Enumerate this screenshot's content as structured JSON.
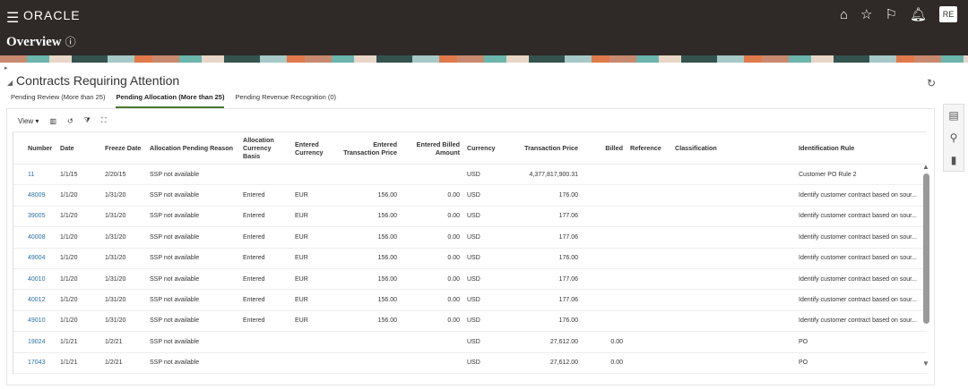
{
  "header": {
    "app": "ORACLE",
    "page_title": "Overview",
    "user_initials": "RE"
  },
  "section": {
    "title": "Contracts Requiring Attention"
  },
  "tabs": [
    {
      "label": "Pending Review (More than 25)"
    },
    {
      "label": "Pending Allocation (More than 25)"
    },
    {
      "label": "Pending Revenue Recognition (0)"
    }
  ],
  "toolbar": {
    "view_label": "View"
  },
  "columns": [
    "Number",
    "Date",
    "Freeze Date",
    "Allocation Pending Reason",
    "Allocation Currency Basis",
    "Entered Currency",
    "Entered Transaction Price",
    "Entered Billed Amount",
    "Currency",
    "Transaction Price",
    "Billed",
    "Reference",
    "Classification",
    "Identification Rule"
  ],
  "rows": [
    [
      "11",
      "1/1/15",
      "2/20/15",
      "SSP not available",
      "",
      "",
      "",
      "",
      "USD",
      "4,377,817,900.31",
      "",
      "",
      "",
      "Customer PO Rule 2"
    ],
    [
      "48009",
      "1/1/20",
      "1/31/20",
      "SSP not available",
      "Entered",
      "EUR",
      "156.00",
      "0.00",
      "USD",
      "176.00",
      "",
      "",
      "",
      "Identify customer contract based on sour..."
    ],
    [
      "39005",
      "1/1/20",
      "1/31/20",
      "SSP not available",
      "Entered",
      "EUR",
      "156.00",
      "0.00",
      "USD",
      "177.06",
      "",
      "",
      "",
      "Identify customer contract based on sour..."
    ],
    [
      "40008",
      "1/1/20",
      "1/31/20",
      "SSP not available",
      "Entered",
      "EUR",
      "156.00",
      "0.00",
      "USD",
      "177.06",
      "",
      "",
      "",
      "Identify customer contract based on sour..."
    ],
    [
      "49004",
      "1/1/20",
      "1/31/20",
      "SSP not available",
      "Entered",
      "EUR",
      "156.00",
      "0.00",
      "USD",
      "176.00",
      "",
      "",
      "",
      "Identify customer contract based on sour..."
    ],
    [
      "40010",
      "1/1/20",
      "1/31/20",
      "SSP not available",
      "Entered",
      "EUR",
      "156.00",
      "0.00",
      "USD",
      "177.06",
      "",
      "",
      "",
      "Identify customer contract based on sour..."
    ],
    [
      "40012",
      "1/1/20",
      "1/31/20",
      "SSP not available",
      "Entered",
      "EUR",
      "156.00",
      "0.00",
      "USD",
      "177.06",
      "",
      "",
      "",
      "Identify customer contract based on sour..."
    ],
    [
      "49010",
      "1/1/20",
      "1/31/20",
      "SSP not available",
      "Entered",
      "EUR",
      "156.00",
      "0.00",
      "USD",
      "176.00",
      "",
      "",
      "",
      "Identify customer contract based on sour..."
    ],
    [
      "19024",
      "1/1/21",
      "1/2/21",
      "SSP not available",
      "",
      "",
      "",
      "",
      "USD",
      "27,612.00",
      "0.00",
      "",
      "",
      "PO"
    ],
    [
      "17043",
      "1/1/21",
      "1/2/21",
      "SSP not available",
      "",
      "",
      "",
      "",
      "USD",
      "27,612.00",
      "0.00",
      "",
      "",
      "PO"
    ]
  ]
}
